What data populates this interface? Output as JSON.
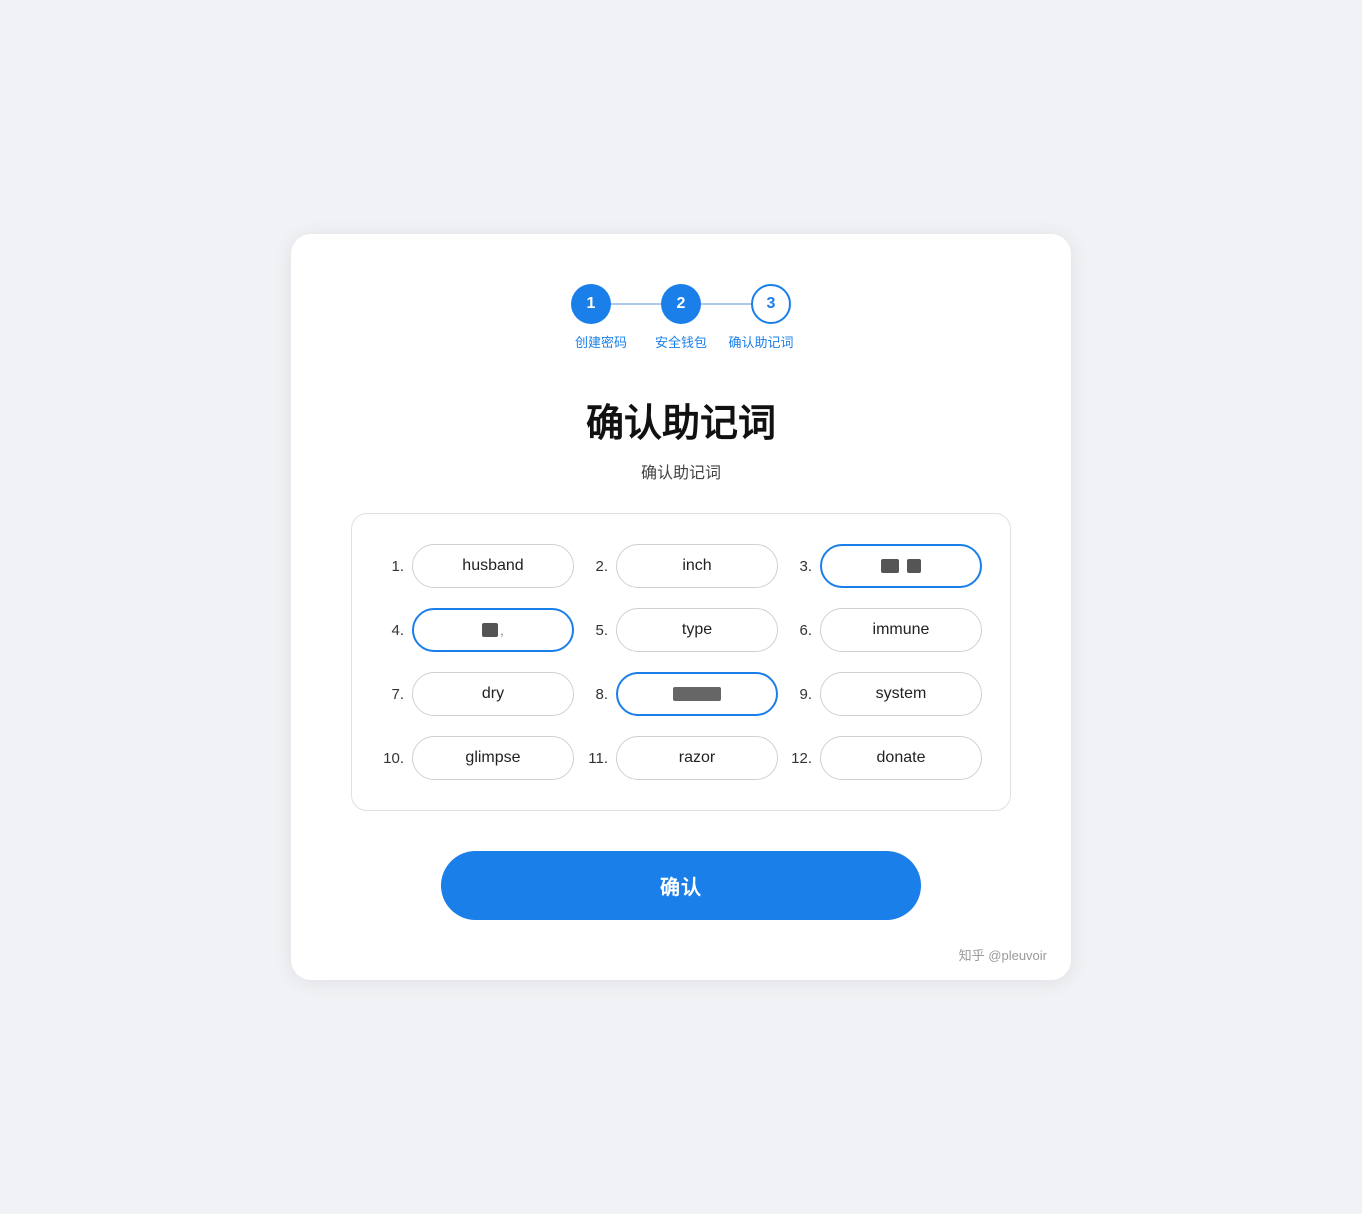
{
  "stepper": {
    "steps": [
      {
        "number": "1",
        "label": "创建密码",
        "state": "active"
      },
      {
        "number": "2",
        "label": "安全钱包",
        "state": "active"
      },
      {
        "number": "3",
        "label": "确认助记词",
        "state": "outline"
      }
    ]
  },
  "page": {
    "title": "确认助记词",
    "subtitle": "确认助记词",
    "confirm_button": "确认"
  },
  "words": [
    {
      "index": 1,
      "label": "husband",
      "state": "normal"
    },
    {
      "index": 2,
      "label": "inch",
      "state": "normal"
    },
    {
      "index": 3,
      "label": "[redacted]",
      "state": "selected-blue"
    },
    {
      "index": 4,
      "label": "[redacted-short]",
      "state": "selected-blue"
    },
    {
      "index": 5,
      "label": "type",
      "state": "normal"
    },
    {
      "index": 6,
      "label": "immune",
      "state": "normal"
    },
    {
      "index": 7,
      "label": "dry",
      "state": "normal"
    },
    {
      "index": 8,
      "label": "[redacted]",
      "state": "selected-blue"
    },
    {
      "index": 9,
      "label": "system",
      "state": "normal"
    },
    {
      "index": 10,
      "label": "glimpse",
      "state": "normal"
    },
    {
      "index": 11,
      "label": "razor",
      "state": "normal"
    },
    {
      "index": 12,
      "label": "donate",
      "state": "normal"
    }
  ],
  "watermark": "知乎 @pleuvoir"
}
